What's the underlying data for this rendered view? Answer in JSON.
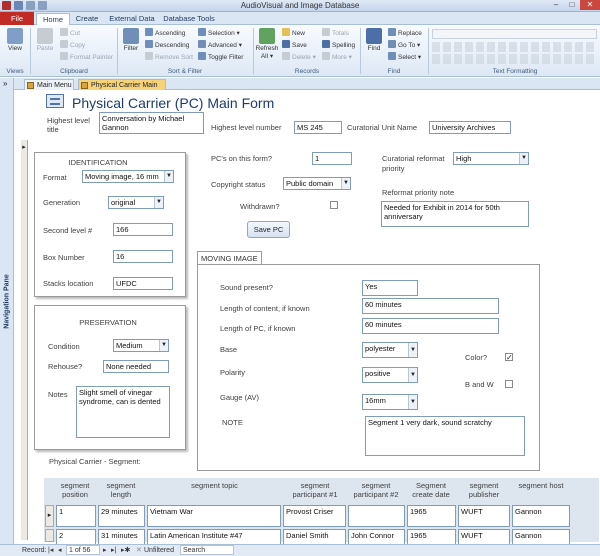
{
  "app": {
    "title": "AudioVisual and Image Database",
    "window_controls": [
      "–",
      "□",
      "✕"
    ]
  },
  "ribbon": {
    "tabs": [
      "File",
      "Home",
      "Create",
      "External Data",
      "Database Tools"
    ],
    "views": {
      "view": "View",
      "group": "Views"
    },
    "clipboard": {
      "paste": "Paste",
      "cut": "Cut",
      "copy": "Copy",
      "format_painter": "Format Painter",
      "group": "Clipboard"
    },
    "sort_filter": {
      "filter": "Filter",
      "ascending": "Ascending",
      "descending": "Descending",
      "remove_sort": "Remove Sort",
      "selection": "Selection ▾",
      "advanced": "Advanced ▾",
      "toggle_filter": "Toggle Filter",
      "group": "Sort & Filter"
    },
    "records": {
      "refresh": "Refresh All ▾",
      "new": "New",
      "save": "Save",
      "delete": "Delete ▾",
      "totals": "Totals",
      "spelling": "Spelling",
      "more": "More ▾",
      "group": "Records"
    },
    "find": {
      "find": "Find",
      "replace": "Replace",
      "goto": "Go To ▾",
      "select": "Select ▾",
      "group": "Find"
    },
    "text_formatting": {
      "group": "Text Formatting"
    }
  },
  "object_tabs": [
    "Main Menu",
    "Physical Carrier Main"
  ],
  "nav_pane": {
    "label": "Navigation Pane",
    "toggle": "»"
  },
  "form": {
    "title": "Physical Carrier (PC) Main Form",
    "highest_level_title_label": "Highest level title",
    "highest_level_title": "Conversation by Michael Gannon",
    "highest_level_number_label": "Highest level number",
    "highest_level_number": "MS 245",
    "curatorial_unit_label": "Curatorial Unit Name",
    "curatorial_unit": "University Archives",
    "identification": {
      "title": "IDENTIFICATION",
      "format_label": "Format",
      "format": "Moving image, 16 mm",
      "generation_label": "Generation",
      "generation": "original",
      "second_level_label": "Second level #",
      "second_level": "166",
      "box_number_label": "Box Number",
      "box_number": "16",
      "stacks_location_label": "Stacks location",
      "stacks_location": "UFDC"
    },
    "preservation": {
      "title": "PRESERVATION",
      "condition_label": "Condition",
      "condition": "Medium",
      "rehouse_label": "Rehouse?",
      "rehouse": "None needed",
      "notes_label": "Notes",
      "notes": "Slight smell of vinegar syndrome, can is dented"
    },
    "pcs_on_form_label": "PC's on this form?",
    "pcs_on_form": "1",
    "copyright_label": "Copyright status",
    "copyright": "Public domain",
    "withdrawn_label": "Withdrawn?",
    "save_pc": "Save PC",
    "reformat_priority_label": "Curatorial reformat priority",
    "reformat_priority": "High",
    "reformat_note_label": "Reformat priority note",
    "reformat_note": "Needed for Exhibit in 2014 for 50th anniversary",
    "moving_image": {
      "tab": "MOVING IMAGE",
      "sound_present_label": "Sound present?",
      "sound_present": "Yes",
      "length_content_label": "Length of content, if known",
      "length_content": "60 minutes",
      "length_pc_label": "Length of PC, if known",
      "length_pc": "60 minutes",
      "base_label": "Base",
      "base": "polyester",
      "polarity_label": "Polarity",
      "polarity": "positive",
      "gauge_label": "Gauge (AV)",
      "gauge": "16mm",
      "color_label": "Color?",
      "color_checked": true,
      "bw_label": "B and W",
      "bw_checked": false,
      "note_label": "NOTE",
      "note": "Segment 1 very dark, sound scratchy"
    },
    "segment_label": "Physical Carrier - Segment:",
    "segment_table": {
      "headers": [
        "segment position",
        "segment length",
        "segment topic",
        "segment participant #1",
        "segment participant #2",
        "Segment create date",
        "segment publisher",
        "segment host"
      ],
      "rows": [
        [
          "1",
          "29 minutes",
          "Vietnam War",
          "Provost Criser",
          "",
          "1965",
          "WUFT",
          "Gannon"
        ],
        [
          "2",
          "31 minutes",
          "Latin American Institute #47",
          "Daniel Smith",
          "John Connor",
          "1965",
          "WUFT",
          "Gannon"
        ]
      ]
    }
  },
  "status": {
    "record_label": "Record:",
    "record_pos": "1 of 56",
    "filter": "Unfiltered",
    "search": "Search"
  }
}
